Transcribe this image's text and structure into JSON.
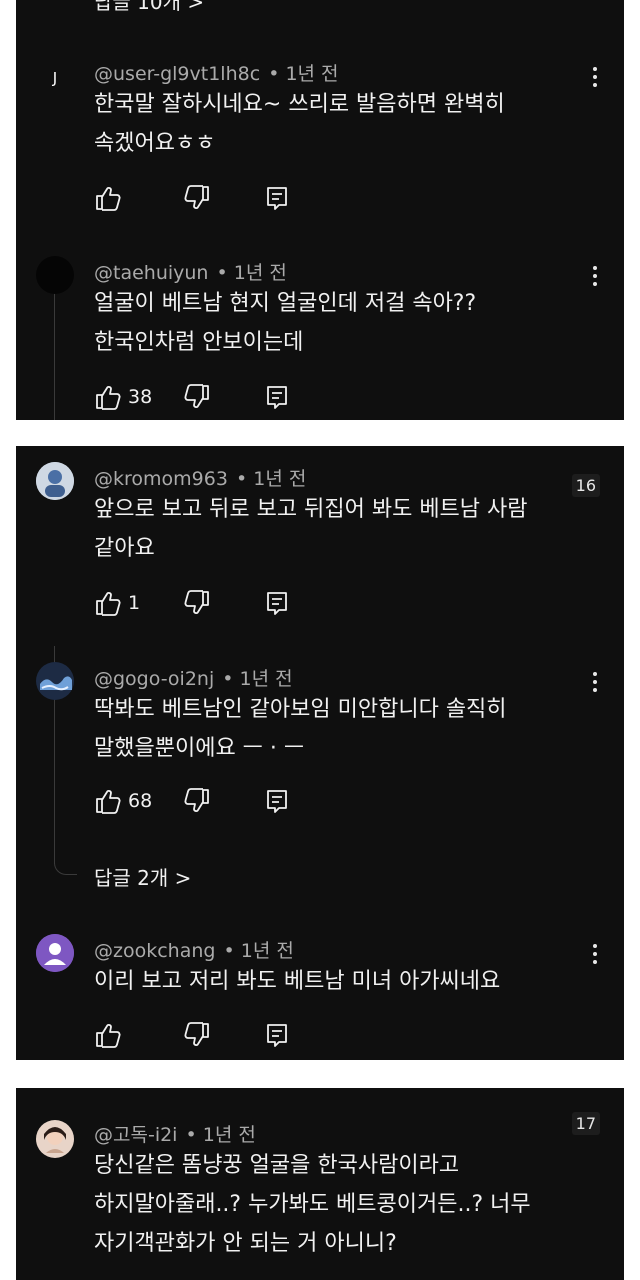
{
  "partial_top_text": "답글 10개 >",
  "comments": [
    {
      "handle": "@user-gl9vt1lh8c",
      "time": "• 1년 전",
      "avatar_letter": "J",
      "avatar_color": "#6b4a3c",
      "lines": [
        "한국말 잘하시네요~ 쓰리로 발음하면 완벽히",
        "속겠어요ㅎㅎ"
      ],
      "likes": ""
    },
    {
      "handle": "@taehuiyun",
      "time": "• 1년 전",
      "avatar_color": "#050505",
      "lines": [
        "얼굴이 베트남 현지 얼굴인데 저걸 속아??",
        "한국인차럼 안보이는데"
      ],
      "likes": "38"
    },
    {
      "handle": "@kromom963",
      "time": "• 1년 전",
      "lines": [
        "앞으로 보고 뒤로 보고 뒤집어 봐도 베트남 사람",
        "같아요"
      ],
      "likes": "1",
      "badge": "16"
    },
    {
      "handle": "@gogo-oi2nj",
      "time": "• 1년 전",
      "lines": [
        "딱봐도 베트남인 같아보임 미안합니다 솔직히",
        "말했을뿐이에요 ㅡ · ㅡ"
      ],
      "likes": "68",
      "replies": "답글 2개 >"
    },
    {
      "handle": "@zookchang",
      "time": "• 1년 전",
      "avatar_color": "#7e57c2",
      "lines": [
        "이리 보고 저리 봐도 베트남 미녀 아가씨네요"
      ],
      "likes": ""
    },
    {
      "handle": "@고독-i2i",
      "time": "• 1년 전",
      "lines": [
        "당신같은 똠냥꿍 얼굴을 한국사람이라고",
        "하지말아줄래..? 누가봐도 베트콩이거든..? 너무",
        "자기객관화가 안 되는 거 아니니?"
      ],
      "badge": "17"
    }
  ],
  "icons": {
    "like": "thumbs-up-icon",
    "dislike": "thumbs-down-icon",
    "reply": "reply-icon",
    "menu": "more-vert-icon"
  },
  "colors": {
    "panel_bg": "#0f0f0f",
    "page_bg": "#ffffff",
    "meta_text": "#aaaaaa",
    "body_text": "#f1f1f1"
  }
}
